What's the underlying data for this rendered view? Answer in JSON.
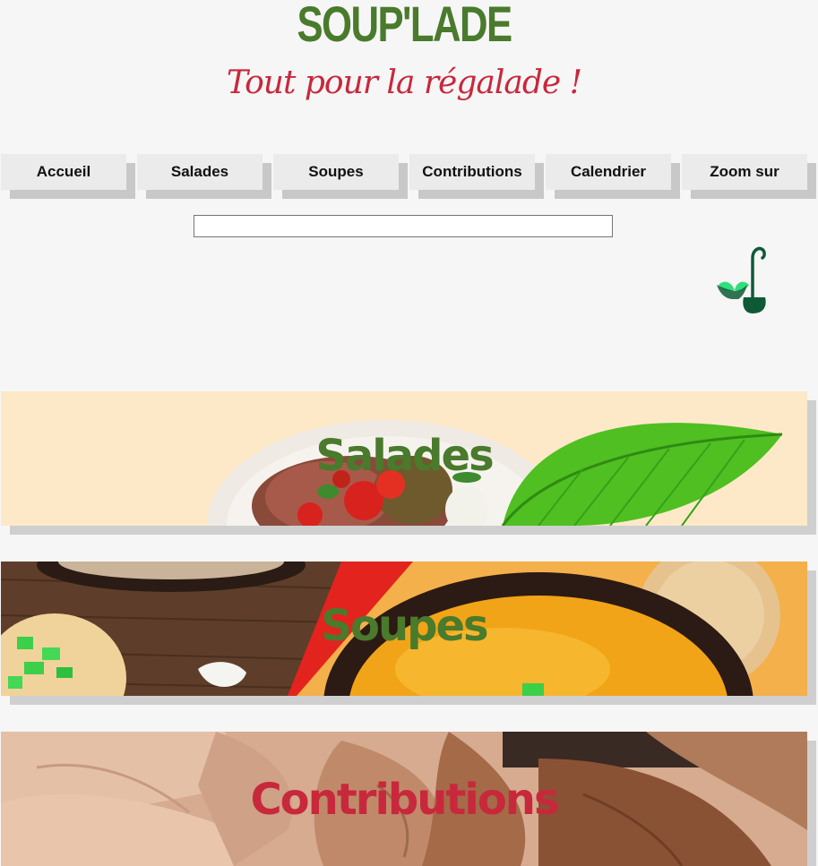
{
  "header": {
    "title": "SOUP'LADE",
    "tagline": "Tout pour la régalade !"
  },
  "nav": {
    "items": [
      {
        "label": "Accueil"
      },
      {
        "label": "Salades"
      },
      {
        "label": "Soupes"
      },
      {
        "label": "Contributions"
      },
      {
        "label": "Calendrier"
      },
      {
        "label": "Zoom sur"
      }
    ]
  },
  "search": {
    "value": "",
    "placeholder": ""
  },
  "logo": {
    "icon": "ladle-leaf-icon"
  },
  "banners": [
    {
      "label": "Salades",
      "color": "#4a7a2c"
    },
    {
      "label": "Soupes",
      "color": "#4a7a2c"
    },
    {
      "label": "Contributions",
      "color": "#c8283c"
    }
  ],
  "colors": {
    "title_green": "#4a7a2c",
    "tagline_red": "#c8283c",
    "background": "#f6f6f6"
  }
}
